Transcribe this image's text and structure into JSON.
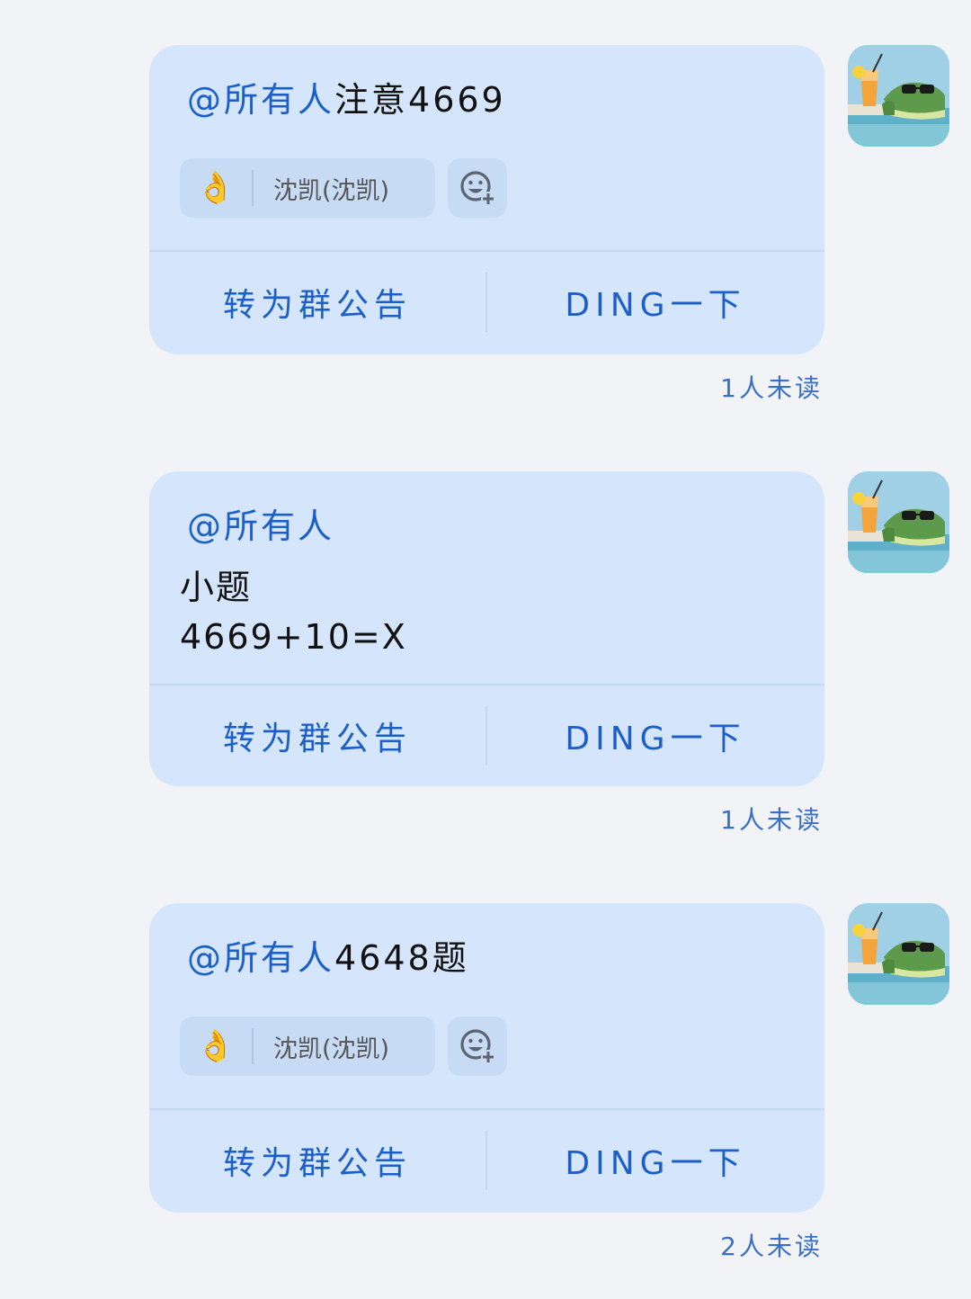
{
  "messages": [
    {
      "mention": "@所有人",
      "text": "注意4669",
      "reaction": {
        "emoji": "👌",
        "user": "沈凯(沈凯)"
      },
      "actions": {
        "announce": "转为群公告",
        "ding": "DING一下"
      },
      "unread": "1人未读"
    },
    {
      "mention": "@所有人",
      "lines": [
        "小题",
        "4669+10=X"
      ],
      "actions": {
        "announce": "转为群公告",
        "ding": "DING一下"
      },
      "unread": "1人未读"
    },
    {
      "mention": "@所有人",
      "text": "4648题",
      "reaction": {
        "emoji": "👌",
        "user": "沈凯(沈凯)"
      },
      "actions": {
        "announce": "转为群公告",
        "ding": "DING一下"
      },
      "unread": "2人未读"
    }
  ],
  "icons": {
    "avatar": "crocodile-sunglasses-avatar-icon",
    "add_reaction": "add-reaction-icon"
  },
  "colors": {
    "bubble": "#d5e6fc",
    "accent": "#1d5fc8",
    "background": "#f1f3f6"
  }
}
